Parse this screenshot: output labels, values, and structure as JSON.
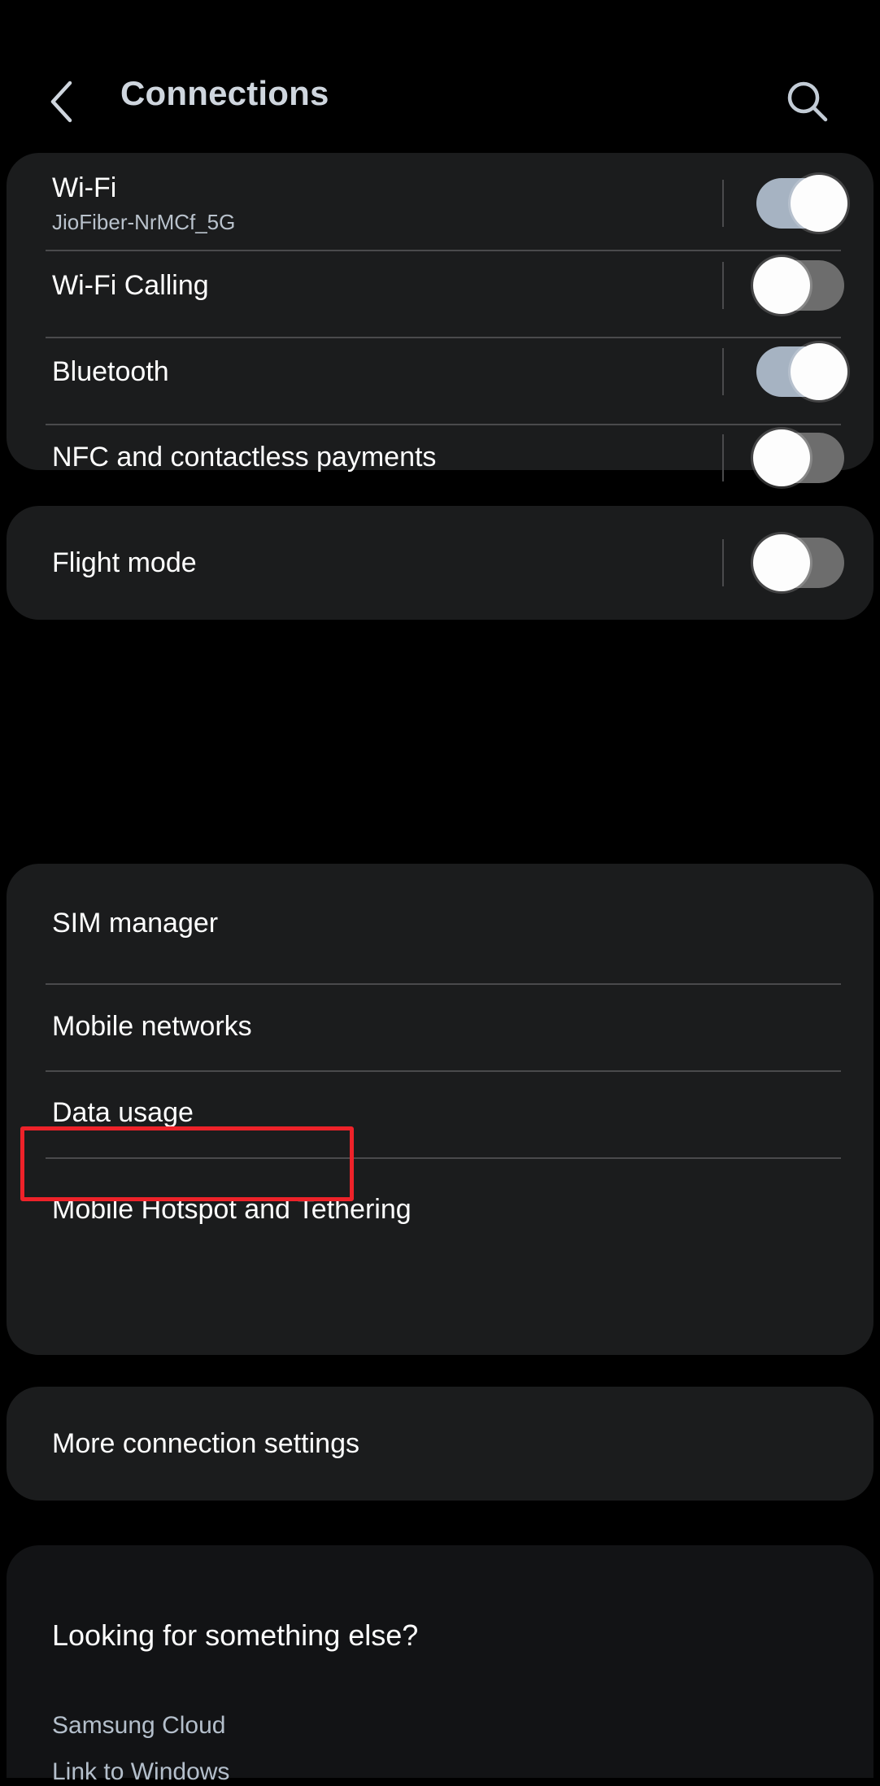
{
  "header": {
    "back_icon": "chevron-left-icon",
    "title": "Connections",
    "search_icon": "search-icon"
  },
  "colors": {
    "page_background": "#000000",
    "card_background": "#1b1c1d",
    "card_background_dim": "#121315",
    "title_text": "#cfd6de",
    "primary_text": "#ffffff",
    "secondary_text": "#b9c2cc",
    "link_text": "#b4bfcb",
    "divider": "#4a4a4c",
    "toggle_on_track": "#a6b3c2",
    "toggle_off_track": "#6d6d6d",
    "toggle_knob": "#fdfdfd",
    "highlight_border": "#ee2229"
  },
  "cards": [
    {
      "name": "wireless-card",
      "rows": [
        {
          "name": "wifi",
          "title": "Wi-Fi",
          "subtitle": "JioFiber-NrMCf_5G",
          "toggle": "on"
        },
        {
          "name": "wifi-calling",
          "title": "Wi-Fi Calling",
          "subtitle": "",
          "toggle": "off"
        },
        {
          "name": "bluetooth",
          "title": "Bluetooth",
          "subtitle": "",
          "toggle": "on"
        },
        {
          "name": "nfc-and-contactless-payments",
          "title": "NFC and contactless payments",
          "subtitle": "",
          "toggle": "off"
        }
      ]
    },
    {
      "name": "flight-mode-card",
      "rows": [
        {
          "name": "flight-mode",
          "title": "Flight mode",
          "subtitle": "",
          "toggle": "off"
        }
      ]
    },
    {
      "name": "mobile-card",
      "rows": [
        {
          "name": "sim-manager",
          "title": "SIM manager"
        },
        {
          "name": "mobile-networks",
          "title": "Mobile networks"
        },
        {
          "name": "data-usage",
          "title": "Data usage",
          "highlighted": true
        },
        {
          "name": "mobile-hotspot-and-tethering",
          "title": "Mobile Hotspot and Tethering"
        }
      ]
    },
    {
      "name": "more-settings-card",
      "rows": [
        {
          "name": "more-connection-settings",
          "title": "More connection settings"
        }
      ]
    }
  ],
  "footer": {
    "name": "looking-for-something-else",
    "title": "Looking for something else?",
    "links": [
      {
        "name": "samsung-cloud",
        "label": "Samsung Cloud"
      },
      {
        "name": "link-to-windows",
        "label": "Link to Windows"
      }
    ]
  }
}
